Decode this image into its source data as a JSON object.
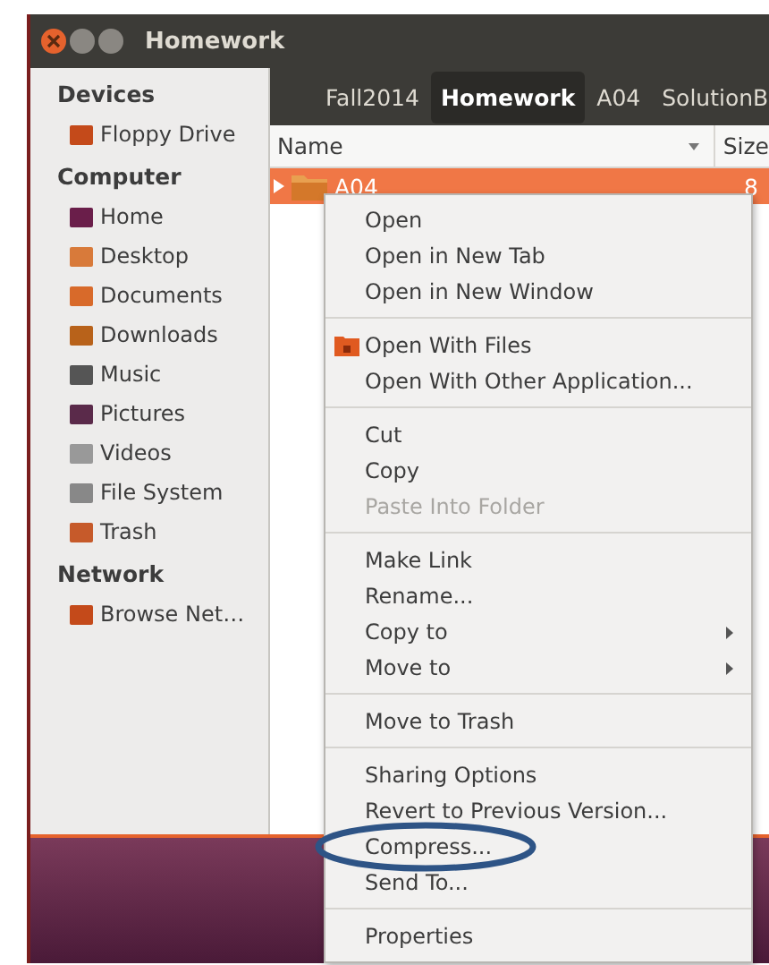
{
  "window": {
    "title": "Homework"
  },
  "sidebar": [
    {
      "heading": "Devices",
      "items": [
        {
          "label": "Floppy Drive"
        }
      ]
    },
    {
      "heading": "Computer",
      "items": [
        {
          "label": "Home"
        },
        {
          "label": "Desktop"
        },
        {
          "label": "Documents"
        },
        {
          "label": "Downloads"
        },
        {
          "label": "Music"
        },
        {
          "label": "Pictures"
        },
        {
          "label": "Videos"
        },
        {
          "label": "File System"
        },
        {
          "label": "Trash"
        }
      ]
    },
    {
      "heading": "Network",
      "items": [
        {
          "label": "Browse Net…"
        }
      ]
    }
  ],
  "breadcrumbs": [
    {
      "label": "Fall2014",
      "selected": false
    },
    {
      "label": "Homework",
      "selected": true
    },
    {
      "label": "A04",
      "selected": false
    },
    {
      "label": "SolutionB",
      "selected": false
    }
  ],
  "columns": [
    {
      "label": "Name",
      "sorted": true
    },
    {
      "label": "Size",
      "sorted": false
    }
  ],
  "rows": [
    {
      "name": "A04",
      "size": "8",
      "selected": true
    }
  ],
  "context_menu": [
    {
      "kind": "item",
      "label": "Open"
    },
    {
      "kind": "item",
      "label": "Open in New Tab"
    },
    {
      "kind": "item",
      "label": "Open in New Window"
    },
    {
      "kind": "separator"
    },
    {
      "kind": "app-item",
      "label": "Open With Files"
    },
    {
      "kind": "item",
      "label": "Open With Other Application..."
    },
    {
      "kind": "separator"
    },
    {
      "kind": "item",
      "label": "Cut"
    },
    {
      "kind": "item",
      "label": "Copy"
    },
    {
      "kind": "item",
      "label": "Paste Into Folder",
      "disabled": true
    },
    {
      "kind": "separator"
    },
    {
      "kind": "item",
      "label": "Make Link"
    },
    {
      "kind": "item",
      "label": "Rename..."
    },
    {
      "kind": "item",
      "label": "Copy to",
      "submenu": true
    },
    {
      "kind": "item",
      "label": "Move to",
      "submenu": true
    },
    {
      "kind": "separator"
    },
    {
      "kind": "item",
      "label": "Move to Trash"
    },
    {
      "kind": "separator"
    },
    {
      "kind": "item",
      "label": "Sharing Options"
    },
    {
      "kind": "item",
      "label": "Revert to Previous Version..."
    },
    {
      "kind": "item",
      "label": "Compress...",
      "highlighted": true
    },
    {
      "kind": "item",
      "label": "Send To..."
    },
    {
      "kind": "separator"
    },
    {
      "kind": "item",
      "label": "Properties"
    }
  ]
}
